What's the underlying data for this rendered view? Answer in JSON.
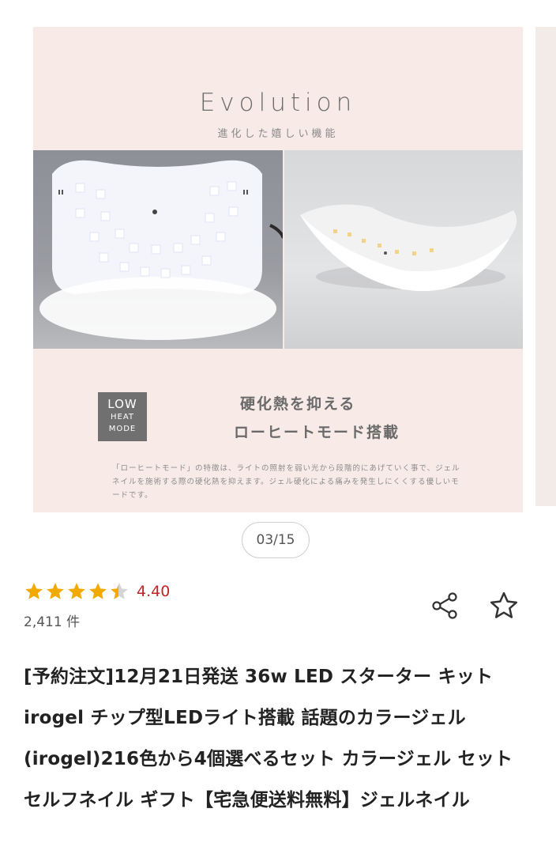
{
  "slide": {
    "title": "Evolution",
    "subtitle": "進化した嬉しい機能",
    "badge_line1": "LOW",
    "badge_line2": "HEAT",
    "badge_line3": "MODE",
    "feature_line1": "硬化熱を抑える",
    "feature_line2": "ローヒートモード搭載",
    "description": "「ローヒートモード」の特徴は、ライトの照射を弱い光から段階的にあげていく事で、ジェルネイルを施術する際の硬化熱を抑えます。ジェル硬化による痛みを発生しにくくする優しいモードです。"
  },
  "carousel": {
    "counter": "03/15"
  },
  "rating": {
    "value": "4.40",
    "count": "2,411 件",
    "score": 4.4,
    "max": 5
  },
  "actions": {
    "share_icon": "share-icon",
    "favorite_icon": "star-outline-icon"
  },
  "product": {
    "title": "[予約注文]12月21日発送 36w LED スターター キット irogel チップ型LEDライト搭載 話題のカラージェル(irogel)216色から4個選べるセット カラージェル セット セルフネイル ギフト【宅急便送料無料】ジェルネイル"
  },
  "colors": {
    "star": "#f2a900",
    "rating_text": "#bf2626",
    "slide_bg": "#f8ebe7"
  }
}
